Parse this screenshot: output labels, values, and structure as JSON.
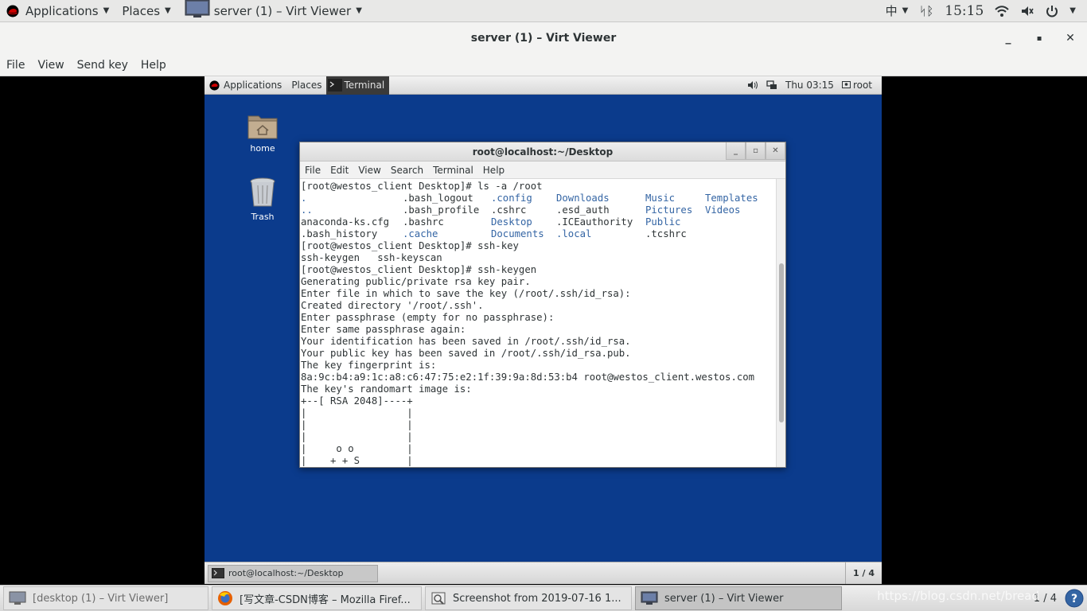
{
  "host_panel": {
    "applications": "Applications",
    "places": "Places",
    "window": "server (1) – Virt Viewer",
    "input_method": "中",
    "keyboard": "ᛋᛒ",
    "clock": "15:15"
  },
  "window": {
    "title": "server (1) – Virt Viewer",
    "minimize": "_",
    "maximize": "▪",
    "close": "✕"
  },
  "menu": [
    "File",
    "View",
    "Send key",
    "Help"
  ],
  "guest_panel": {
    "applications": "Applications",
    "places": "Places",
    "terminal": "Terminal",
    "clock": "Thu 03:15",
    "user": "root"
  },
  "desktop_icons": {
    "home": "home",
    "trash": "Trash"
  },
  "terminal": {
    "title": "root@localhost:~/Desktop",
    "menu": [
      "File",
      "Edit",
      "View",
      "Search",
      "Terminal",
      "Help"
    ],
    "lines_before": [
      "[root@westos_client Desktop]# ls -a /root"
    ],
    "ls_rows": [
      [
        {
          "t": ".",
          "d": true
        },
        {
          "t": ".bash_logout",
          "d": false
        },
        {
          "t": ".config",
          "d": true
        },
        {
          "t": "Downloads",
          "d": true
        },
        {
          "t": "Music",
          "d": true
        },
        {
          "t": "Templates",
          "d": true
        }
      ],
      [
        {
          "t": "..",
          "d": true
        },
        {
          "t": ".bash_profile",
          "d": false
        },
        {
          "t": ".cshrc",
          "d": false
        },
        {
          "t": ".esd_auth",
          "d": false
        },
        {
          "t": "Pictures",
          "d": true
        },
        {
          "t": "Videos",
          "d": true
        }
      ],
      [
        {
          "t": "anaconda-ks.cfg",
          "d": false
        },
        {
          "t": ".bashrc",
          "d": false
        },
        {
          "t": "Desktop",
          "d": true
        },
        {
          "t": ".ICEauthority",
          "d": false
        },
        {
          "t": "Public",
          "d": true
        },
        {
          "t": "",
          "d": false
        }
      ],
      [
        {
          "t": ".bash_history",
          "d": false
        },
        {
          "t": ".cache",
          "d": true
        },
        {
          "t": "Documents",
          "d": true
        },
        {
          "t": ".local",
          "d": true
        },
        {
          "t": ".tcshrc",
          "d": false
        },
        {
          "t": "",
          "d": false
        }
      ]
    ],
    "lines_after": [
      "[root@westos_client Desktop]# ssh-key",
      "ssh-keygen   ssh-keyscan",
      "[root@westos_client Desktop]# ssh-keygen",
      "Generating public/private rsa key pair.",
      "Enter file in which to save the key (/root/.ssh/id_rsa):",
      "Created directory '/root/.ssh'.",
      "Enter passphrase (empty for no passphrase):",
      "Enter same passphrase again:",
      "Your identification has been saved in /root/.ssh/id_rsa.",
      "Your public key has been saved in /root/.ssh/id_rsa.pub.",
      "The key fingerprint is:",
      "8a:9c:b4:a9:1c:a8:c6:47:75:e2:1f:39:9a:8d:53:b4 root@westos_client.westos.com",
      "The key's randomart image is:",
      "+--[ RSA 2048]----+",
      "|                 |",
      "|                 |",
      "|                 |",
      "|     o o         |",
      "|    + + S        |"
    ]
  },
  "guest_taskbar": {
    "task": "root@localhost:~/Desktop",
    "workspace": "1 / 4"
  },
  "host_taskbar": {
    "tasks": [
      "[desktop (1) – Virt Viewer]",
      "[写文章-CSDN博客 – Mozilla Firef...",
      "Screenshot from 2019-07-16 1...",
      "server (1) – Virt Viewer"
    ],
    "workspace": "1 / 4",
    "watermark": "https://blog.csdn.net/bread"
  }
}
